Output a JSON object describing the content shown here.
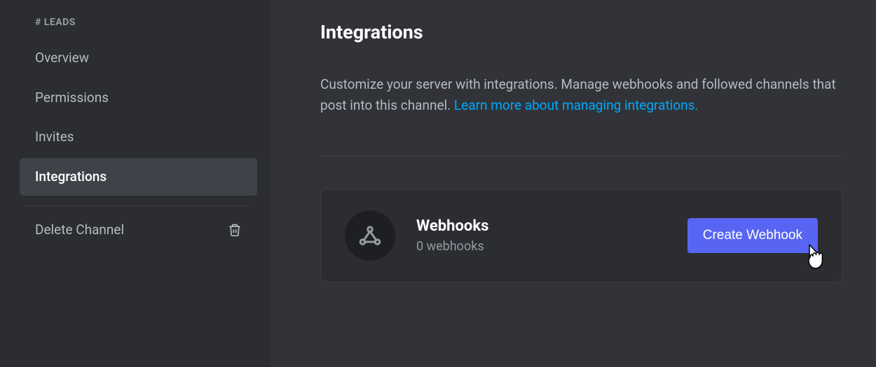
{
  "sidebar": {
    "channel_label": "# LEADS",
    "items": [
      {
        "label": "Overview"
      },
      {
        "label": "Permissions"
      },
      {
        "label": "Invites"
      },
      {
        "label": "Integrations"
      }
    ],
    "delete_label": "Delete Channel"
  },
  "main": {
    "title": "Integrations",
    "description_text": "Customize your server with integrations. Manage webhooks and followed channels that post into this channel. ",
    "description_link": "Learn more about managing integrations.",
    "webhooks": {
      "title": "Webhooks",
      "subtitle": "0 webhooks",
      "create_button": "Create Webhook"
    }
  }
}
